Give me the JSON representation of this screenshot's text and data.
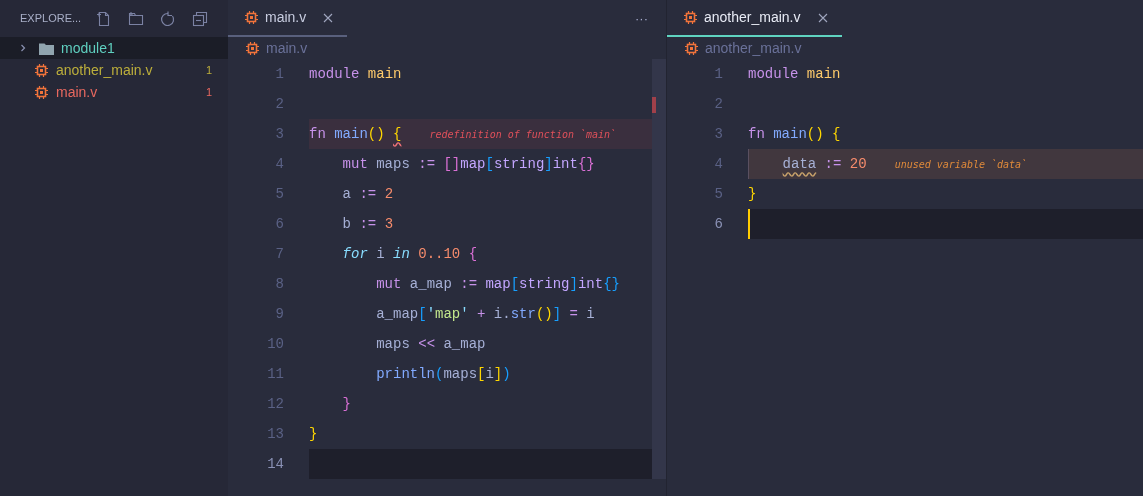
{
  "sidebar": {
    "title": "EXPLORE...",
    "tree": [
      {
        "kind": "folder",
        "label": "module1",
        "expanded": false,
        "selected": true
      },
      {
        "kind": "file",
        "label": "another_main.v",
        "color": "#bcae3b",
        "badge": "1",
        "selected": false
      },
      {
        "kind": "file",
        "label": "main.v",
        "color": "#e8685f",
        "badge": "1",
        "selected": false
      }
    ]
  },
  "editors": [
    {
      "active": false,
      "tabs": [
        {
          "label": "main.v",
          "selected": true
        }
      ],
      "more": "···",
      "breadcrumb": "main.v",
      "lines": [
        {
          "number": "1",
          "current": false,
          "cursor": false,
          "tokens": [
            {
              "text": "module",
              "kind": "keyword"
            },
            {
              "text": " main",
              "kind": "module"
            }
          ]
        },
        {
          "number": "2",
          "current": false,
          "cursor": false
        },
        {
          "number": "3",
          "current": false,
          "cursor": false,
          "diagnostic": {
            "kind": "error",
            "message": "redefinition of function `main`"
          },
          "tokens": [
            {
              "text": "fn",
              "kind": "keyword"
            },
            {
              "text": " main",
              "kind": "function"
            },
            {
              "text": "()",
              "kind": "bracket1"
            },
            {
              "text": " {",
              "kind": "bracket1",
              "squiggle": true
            }
          ]
        },
        {
          "number": "4",
          "current": false,
          "cursor": false,
          "tokens": [
            {
              "text": "    mut",
              "kind": "keyword"
            },
            {
              "text": " maps",
              "kind": "variable"
            },
            {
              "text": " :=",
              "kind": "operator"
            },
            {
              "text": " []",
              "kind": "bracket2"
            },
            {
              "text": "map",
              "kind": "type"
            },
            {
              "text": "[",
              "kind": "bracket3"
            },
            {
              "text": "string",
              "kind": "type"
            },
            {
              "text": "]",
              "kind": "bracket3"
            },
            {
              "text": "int",
              "kind": "type"
            },
            {
              "text": "{}",
              "kind": "bracket2"
            }
          ]
        },
        {
          "number": "5",
          "current": false,
          "cursor": false,
          "tokens": [
            {
              "text": "    a",
              "kind": "variable"
            },
            {
              "text": " :=",
              "kind": "operator"
            },
            {
              "text": " 2",
              "kind": "number"
            }
          ]
        },
        {
          "number": "6",
          "current": false,
          "cursor": false,
          "tokens": [
            {
              "text": "    b",
              "kind": "variable"
            },
            {
              "text": " :=",
              "kind": "operator"
            },
            {
              "text": " 3",
              "kind": "number"
            }
          ]
        },
        {
          "number": "7",
          "current": false,
          "cursor": false,
          "tokens": [
            {
              "text": "    for",
              "kind": "control"
            },
            {
              "text": " i",
              "kind": "variable"
            },
            {
              "text": " in",
              "kind": "control"
            },
            {
              "text": " 0..10",
              "kind": "number"
            },
            {
              "text": " {",
              "kind": "bracket2"
            }
          ]
        },
        {
          "number": "8",
          "current": false,
          "cursor": false,
          "tokens": [
            {
              "text": "        mut",
              "kind": "keyword"
            },
            {
              "text": " a_map",
              "kind": "variable"
            },
            {
              "text": " :=",
              "kind": "operator"
            },
            {
              "text": " map",
              "kind": "type"
            },
            {
              "text": "[",
              "kind": "bracket3"
            },
            {
              "text": "string",
              "kind": "type"
            },
            {
              "text": "]",
              "kind": "bracket3"
            },
            {
              "text": "int",
              "kind": "type"
            },
            {
              "text": "{}",
              "kind": "bracket3"
            }
          ]
        },
        {
          "number": "9",
          "current": false,
          "cursor": false,
          "tokens": [
            {
              "text": "        a_map",
              "kind": "variable"
            },
            {
              "text": "[",
              "kind": "bracket3"
            },
            {
              "text": "'",
              "kind": "quote"
            },
            {
              "text": "map",
              "kind": "string"
            },
            {
              "text": "'",
              "kind": "quote"
            },
            {
              "text": " +",
              "kind": "operator"
            },
            {
              "text": " i",
              "kind": "variable"
            },
            {
              "text": ".",
              "kind": "plain"
            },
            {
              "text": "str",
              "kind": "function"
            },
            {
              "text": "()",
              "kind": "bracket1"
            },
            {
              "text": "]",
              "kind": "bracket3"
            },
            {
              "text": " =",
              "kind": "operator"
            },
            {
              "text": " i",
              "kind": "variable"
            }
          ]
        },
        {
          "number": "10",
          "current": false,
          "cursor": false,
          "tokens": [
            {
              "text": "        maps",
              "kind": "variable"
            },
            {
              "text": " <<",
              "kind": "operator"
            },
            {
              "text": " a_map",
              "kind": "variable"
            }
          ]
        },
        {
          "number": "11",
          "current": false,
          "cursor": false,
          "tokens": [
            {
              "text": "        println",
              "kind": "function"
            },
            {
              "text": "(",
              "kind": "bracket3"
            },
            {
              "text": "maps",
              "kind": "variable"
            },
            {
              "text": "[",
              "kind": "bracket1"
            },
            {
              "text": "i",
              "kind": "variable"
            },
            {
              "text": "]",
              "kind": "bracket1"
            },
            {
              "text": ")",
              "kind": "bracket3"
            }
          ]
        },
        {
          "number": "12",
          "current": false,
          "cursor": false,
          "tokens": [
            {
              "text": "    }",
              "kind": "bracket2"
            }
          ]
        },
        {
          "number": "13",
          "current": false,
          "cursor": false,
          "tokens": [
            {
              "text": "}",
              "kind": "bracket1"
            }
          ]
        },
        {
          "number": "14",
          "current": true,
          "cursor": false
        }
      ]
    },
    {
      "active": true,
      "tabs": [
        {
          "label": "another_main.v",
          "selected": true
        }
      ],
      "breadcrumb": "another_main.v",
      "lines": [
        {
          "number": "1",
          "current": false,
          "cursor": false,
          "tokens": [
            {
              "text": "module",
              "kind": "keyword"
            },
            {
              "text": " main",
              "kind": "module"
            }
          ]
        },
        {
          "number": "2",
          "current": false,
          "cursor": false
        },
        {
          "number": "3",
          "current": false,
          "cursor": false,
          "tokens": [
            {
              "text": "fn",
              "kind": "keyword"
            },
            {
              "text": " main",
              "kind": "function"
            },
            {
              "text": "()",
              "kind": "bracket1"
            },
            {
              "text": " {",
              "kind": "bracket1"
            }
          ]
        },
        {
          "number": "4",
          "current": false,
          "cursor": false,
          "diagnostic": {
            "kind": "warning",
            "message": "unused variable `data`"
          },
          "tokens": [
            {
              "text": "    data",
              "kind": "variable",
              "squiggle": true
            },
            {
              "text": " :=",
              "kind": "operator"
            },
            {
              "text": " 20",
              "kind": "number"
            }
          ]
        },
        {
          "number": "5",
          "current": false,
          "cursor": false,
          "tokens": [
            {
              "text": "}",
              "kind": "bracket1"
            }
          ]
        },
        {
          "number": "6",
          "current": true,
          "cursor": true
        }
      ]
    }
  ]
}
